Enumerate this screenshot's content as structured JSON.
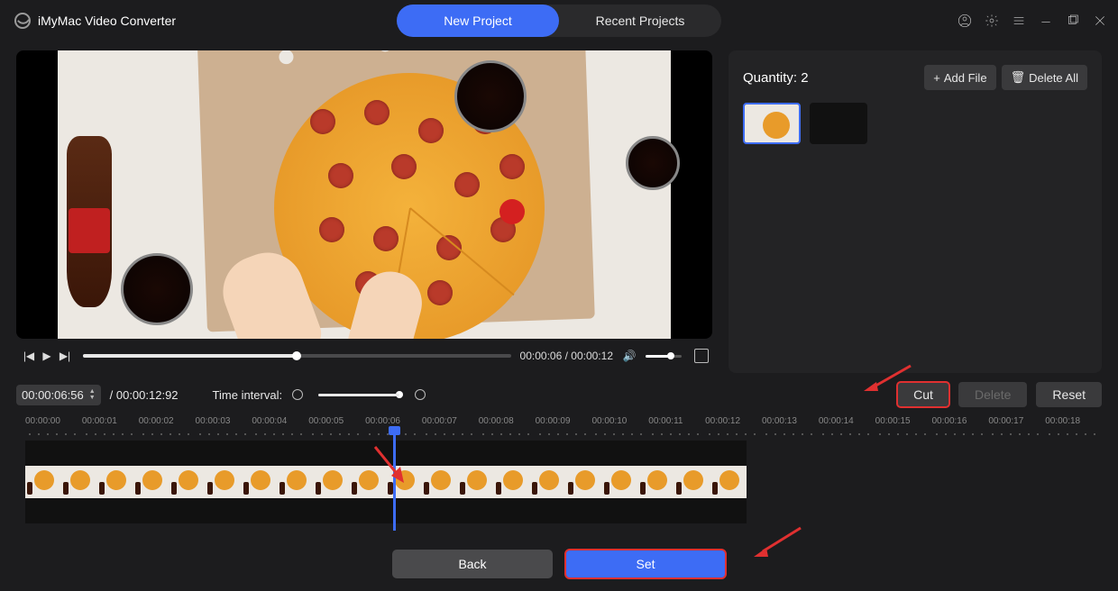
{
  "app": {
    "title": "iMyMac Video Converter"
  },
  "tabs": {
    "new_project": "New Project",
    "recent_projects": "Recent Projects"
  },
  "player": {
    "current_time": "00:00:06",
    "duration": "00:00:12"
  },
  "editor": {
    "time_value": "00:00:06:56",
    "duration_label": "00:00:12:92",
    "interval_label": "Time interval:"
  },
  "actions": {
    "cut": "Cut",
    "delete": "Delete",
    "reset": "Reset"
  },
  "side": {
    "quantity_label": "Quantity:",
    "quantity_value": "2",
    "add_file": "Add File",
    "delete_all": "Delete All"
  },
  "ruler": {
    "ticks": [
      "00:00:00",
      "00:00:01",
      "00:00:02",
      "00:00:03",
      "00:00:04",
      "00:00:05",
      "00:00:06",
      "00:00:07",
      "00:00:08",
      "00:00:09",
      "00:00:10",
      "00:00:11",
      "00:00:12",
      "00:00:13",
      "00:00:14",
      "00:00:15",
      "00:00:16",
      "00:00:17",
      "00:00:18"
    ]
  },
  "bottom": {
    "back": "Back",
    "set": "Set"
  }
}
